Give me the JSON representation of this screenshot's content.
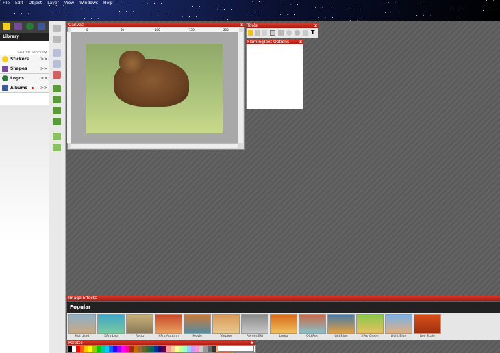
{
  "menu": [
    "File",
    "Edit",
    "Object",
    "Layer",
    "View",
    "Windows",
    "Help"
  ],
  "library": {
    "title": "Library",
    "search_placeholder": "Search Stocks",
    "items": [
      {
        "label": "Stickers",
        "icon": "smiley-icon",
        "color": "#f5d020"
      },
      {
        "label": "Shapes",
        "icon": "shapes-icon",
        "color": "#7a4a9a"
      },
      {
        "label": "Logos",
        "icon": "logo-icon",
        "color": "#2a7a3a"
      },
      {
        "label": "Albums",
        "icon": "facebook-icon",
        "color": "#3b5998"
      }
    ],
    "chevron": ">>"
  },
  "panels": {
    "canvas": "Canvas",
    "tools": "Tools",
    "flamingtext": "FlamingText Options",
    "close": "x"
  },
  "ruler_ticks": [
    "0",
    "50",
    "100",
    "150",
    "200",
    "250"
  ],
  "effects": {
    "title": "Image Effects",
    "section": "Popular",
    "items": [
      {
        "label": "Not Used",
        "tint": "#8fb0c8"
      },
      {
        "label": "XPro Lab",
        "tint": "#3fa6c8"
      },
      {
        "label": "Retro",
        "tint": "#c8b07a"
      },
      {
        "label": "XPro Autumn",
        "tint": "#c84a2a"
      },
      {
        "label": "Movie",
        "tint": "#c87a3a"
      },
      {
        "label": "Vintage",
        "tint": "#d89a5a"
      },
      {
        "label": "Paynes BW",
        "tint": "#8a8a8a"
      },
      {
        "label": "Lomo",
        "tint": "#d86a1a"
      },
      {
        "label": "Old Red",
        "tint": "#c86a4a"
      },
      {
        "label": "Old Blue",
        "tint": "#4a7aa8"
      },
      {
        "label": "XPro Green",
        "tint": "#8ac84a"
      },
      {
        "label": "Light Blue",
        "tint": "#7ab0e8"
      },
      {
        "label": "Red Scale",
        "tint": "#d8501a"
      }
    ]
  },
  "palette": {
    "title": "Palette",
    "colors": [
      "#000000",
      "#ffffff",
      "#ff0000",
      "#ff6600",
      "#ffcc00",
      "#ffff00",
      "#99cc00",
      "#00cc00",
      "#00cc99",
      "#00ccff",
      "#0066ff",
      "#3300ff",
      "#9900ff",
      "#ff00ff",
      "#ff0099",
      "#993300",
      "#cc6600",
      "#996633",
      "#666633",
      "#336633",
      "#006666",
      "#003399",
      "#330066",
      "#660033",
      "#ff9999",
      "#ffcc99",
      "#ffff99",
      "#ccff99",
      "#99ffcc",
      "#99ccff",
      "#cc99ff",
      "#ff99cc",
      "#cccccc",
      "#999999",
      "#666666",
      "#333333",
      "#ffaa66",
      "#aa6633",
      "#ff4444",
      "#ffdd55"
    ]
  }
}
